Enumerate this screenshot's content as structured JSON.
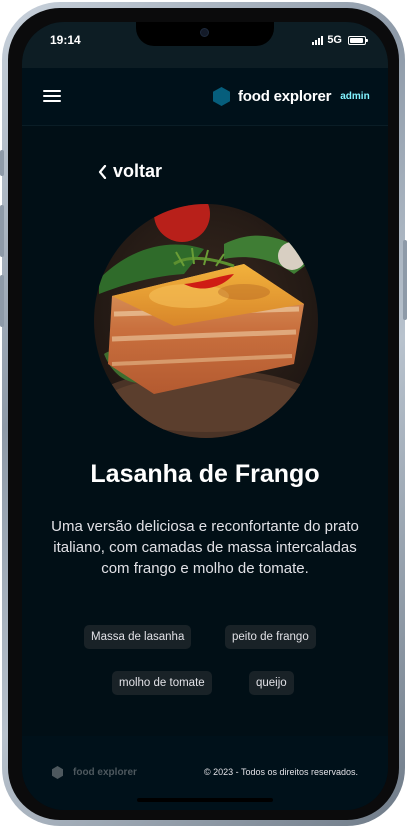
{
  "status_bar": {
    "time": "19:14",
    "network": "5G",
    "icons": [
      "signal-icon",
      "battery-icon"
    ]
  },
  "header": {
    "menu_icon": "hamburger-menu-icon",
    "logo_icon": "hexagon-icon",
    "brand": "food explorer",
    "badge": "admin"
  },
  "back": {
    "icon": "chevron-left-icon",
    "label": "voltar"
  },
  "dish": {
    "image_subject": "lasagna",
    "title": "Lasanha de Frango",
    "description": "Uma versão deliciosa e reconfortante do prato italiano, com camadas de massa intercaladas com frango e molho de tomate.",
    "ingredients": [
      "Massa de lasanha",
      "peito de frango",
      "molho de tomate",
      "queijo"
    ]
  },
  "footer": {
    "logo_icon": "hexagon-icon",
    "brand": "food explorer",
    "copyright": "© 2023 - Todos os direitos reservados."
  },
  "colors": {
    "background": "#010f16",
    "header": "#00111a",
    "accent": "#065e7c",
    "badge": "#82f3ff",
    "tag_bg": "#192227",
    "text": "#e1e1e6"
  }
}
